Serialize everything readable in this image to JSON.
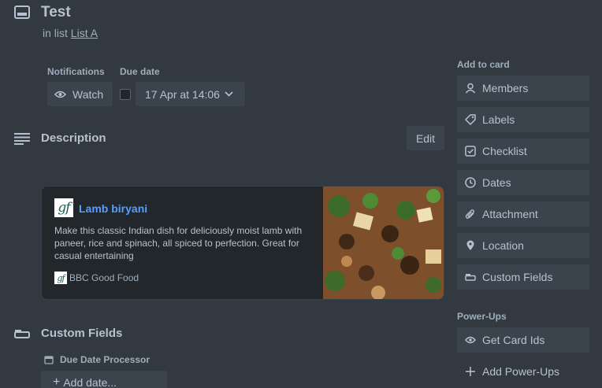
{
  "header": {
    "title": "Test",
    "in_list_prefix": "in list",
    "list_name": "List A"
  },
  "notifications": {
    "label": "Notifications",
    "watch_label": "Watch"
  },
  "due_date": {
    "label": "Due date",
    "value": "17 Apr at 14:06"
  },
  "description": {
    "title": "Description",
    "edit_label": "Edit",
    "preview": {
      "logo_text": "gf",
      "title": "Lamb biryani",
      "text": "Make this classic Indian dish for deliciously moist lamb with paneer, rice and spinach, all spiced to perfection. Great for casual entertaining",
      "source": "BBC Good Food"
    }
  },
  "custom_fields": {
    "title": "Custom Fields",
    "field_label": "Due Date Processor",
    "add_date_label": "Add date..."
  },
  "sidebar": {
    "add_to_card_label": "Add to card",
    "items": [
      {
        "label": "Members",
        "icon": "person-icon"
      },
      {
        "label": "Labels",
        "icon": "tag-icon"
      },
      {
        "label": "Checklist",
        "icon": "checkbox-icon"
      },
      {
        "label": "Dates",
        "icon": "clock-icon"
      },
      {
        "label": "Attachment",
        "icon": "paperclip-icon"
      },
      {
        "label": "Location",
        "icon": "pin-icon"
      },
      {
        "label": "Custom Fields",
        "icon": "custom-fields-icon"
      }
    ],
    "power_ups_label": "Power-Ups",
    "power_ups": [
      {
        "label": "Get Card Ids",
        "icon": "eye-icon"
      }
    ],
    "add_power_ups_label": "Add Power-Ups"
  },
  "colors": {
    "background": "#323940",
    "button": "#3b444c",
    "text": "#b6c2cf",
    "link": "#579dff"
  }
}
